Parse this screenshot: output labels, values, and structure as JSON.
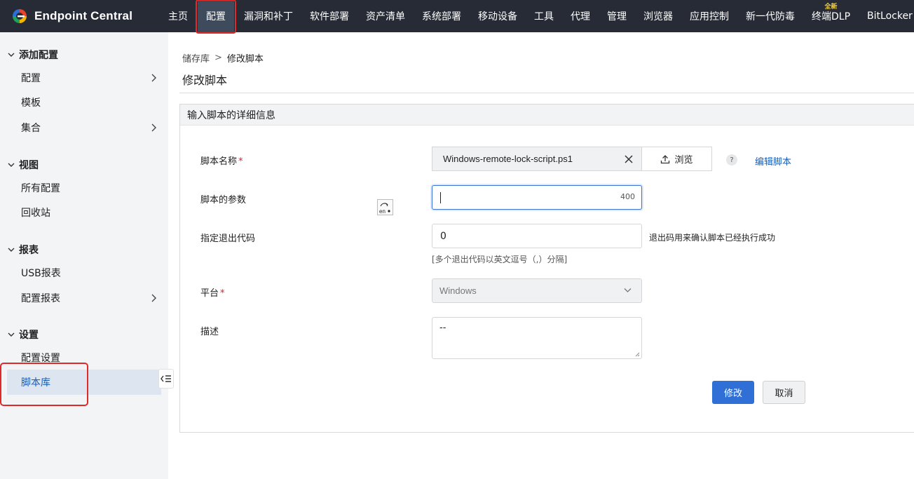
{
  "brand": {
    "name": "Endpoint Central",
    "logo_icon": "endpoint-central-logo-icon"
  },
  "nav": {
    "items": [
      {
        "label": "主页",
        "active": false
      },
      {
        "label": "配置",
        "active": true
      },
      {
        "label": "漏洞和补丁",
        "active": false
      },
      {
        "label": "软件部署",
        "active": false
      },
      {
        "label": "资产清单",
        "active": false
      },
      {
        "label": "系统部署",
        "active": false
      },
      {
        "label": "移动设备",
        "active": false
      },
      {
        "label": "工具",
        "active": false
      },
      {
        "label": "代理",
        "active": false
      },
      {
        "label": "管理",
        "active": false
      },
      {
        "label": "浏览器",
        "active": false
      },
      {
        "label": "应用控制",
        "active": false
      },
      {
        "label": "新一代防毒",
        "active": false
      },
      {
        "label": "终端DLP",
        "badge": "全新",
        "active": false
      },
      {
        "label": "BitLocker",
        "active": false
      }
    ]
  },
  "sidebar": {
    "sections": [
      {
        "title": "添加配置",
        "items": [
          {
            "label": "配置",
            "has_children": true
          },
          {
            "label": "模板"
          },
          {
            "label": "集合",
            "has_children": true
          }
        ]
      },
      {
        "title": "视图",
        "items": [
          {
            "label": "所有配置"
          },
          {
            "label": "回收站"
          }
        ]
      },
      {
        "title": "报表",
        "items": [
          {
            "label": "USB报表"
          },
          {
            "label": "配置报表",
            "has_children": true
          }
        ]
      },
      {
        "title": "设置",
        "items": [
          {
            "label": "配置设置"
          },
          {
            "label": "脚本库",
            "selected": true
          }
        ]
      }
    ]
  },
  "breadcrumb": {
    "parent": "储存库",
    "separator": ">",
    "current": "修改脚本"
  },
  "page": {
    "title": "修改脚本"
  },
  "form": {
    "panel_title": "输入脚本的详细信息",
    "script_name": {
      "label": "脚本名称",
      "required": true,
      "value": "Windows-remote-lock-script.ps1",
      "browse_label": "浏览",
      "help": "?",
      "edit_link": "编辑脚本"
    },
    "params": {
      "label": "脚本的参数",
      "value": "",
      "counter": "400",
      "ime_text": "en"
    },
    "exit_code": {
      "label": "指定退出代码",
      "value": "0",
      "note": "退出码用来确认脚本已经执行成功",
      "hint": "[多个退出代码以英文逗号（,）分隔]"
    },
    "platform": {
      "label": "平台",
      "required": true,
      "value": "Windows"
    },
    "description": {
      "label": "描述",
      "value": "--"
    },
    "submit_label": "修改",
    "cancel_label": "取消"
  },
  "colors": {
    "topbar": "#262b36",
    "primary": "#2f6fd6",
    "link": "#1a5fb4",
    "required": "#d9232e",
    "highlight_box": "#e02a2a"
  }
}
